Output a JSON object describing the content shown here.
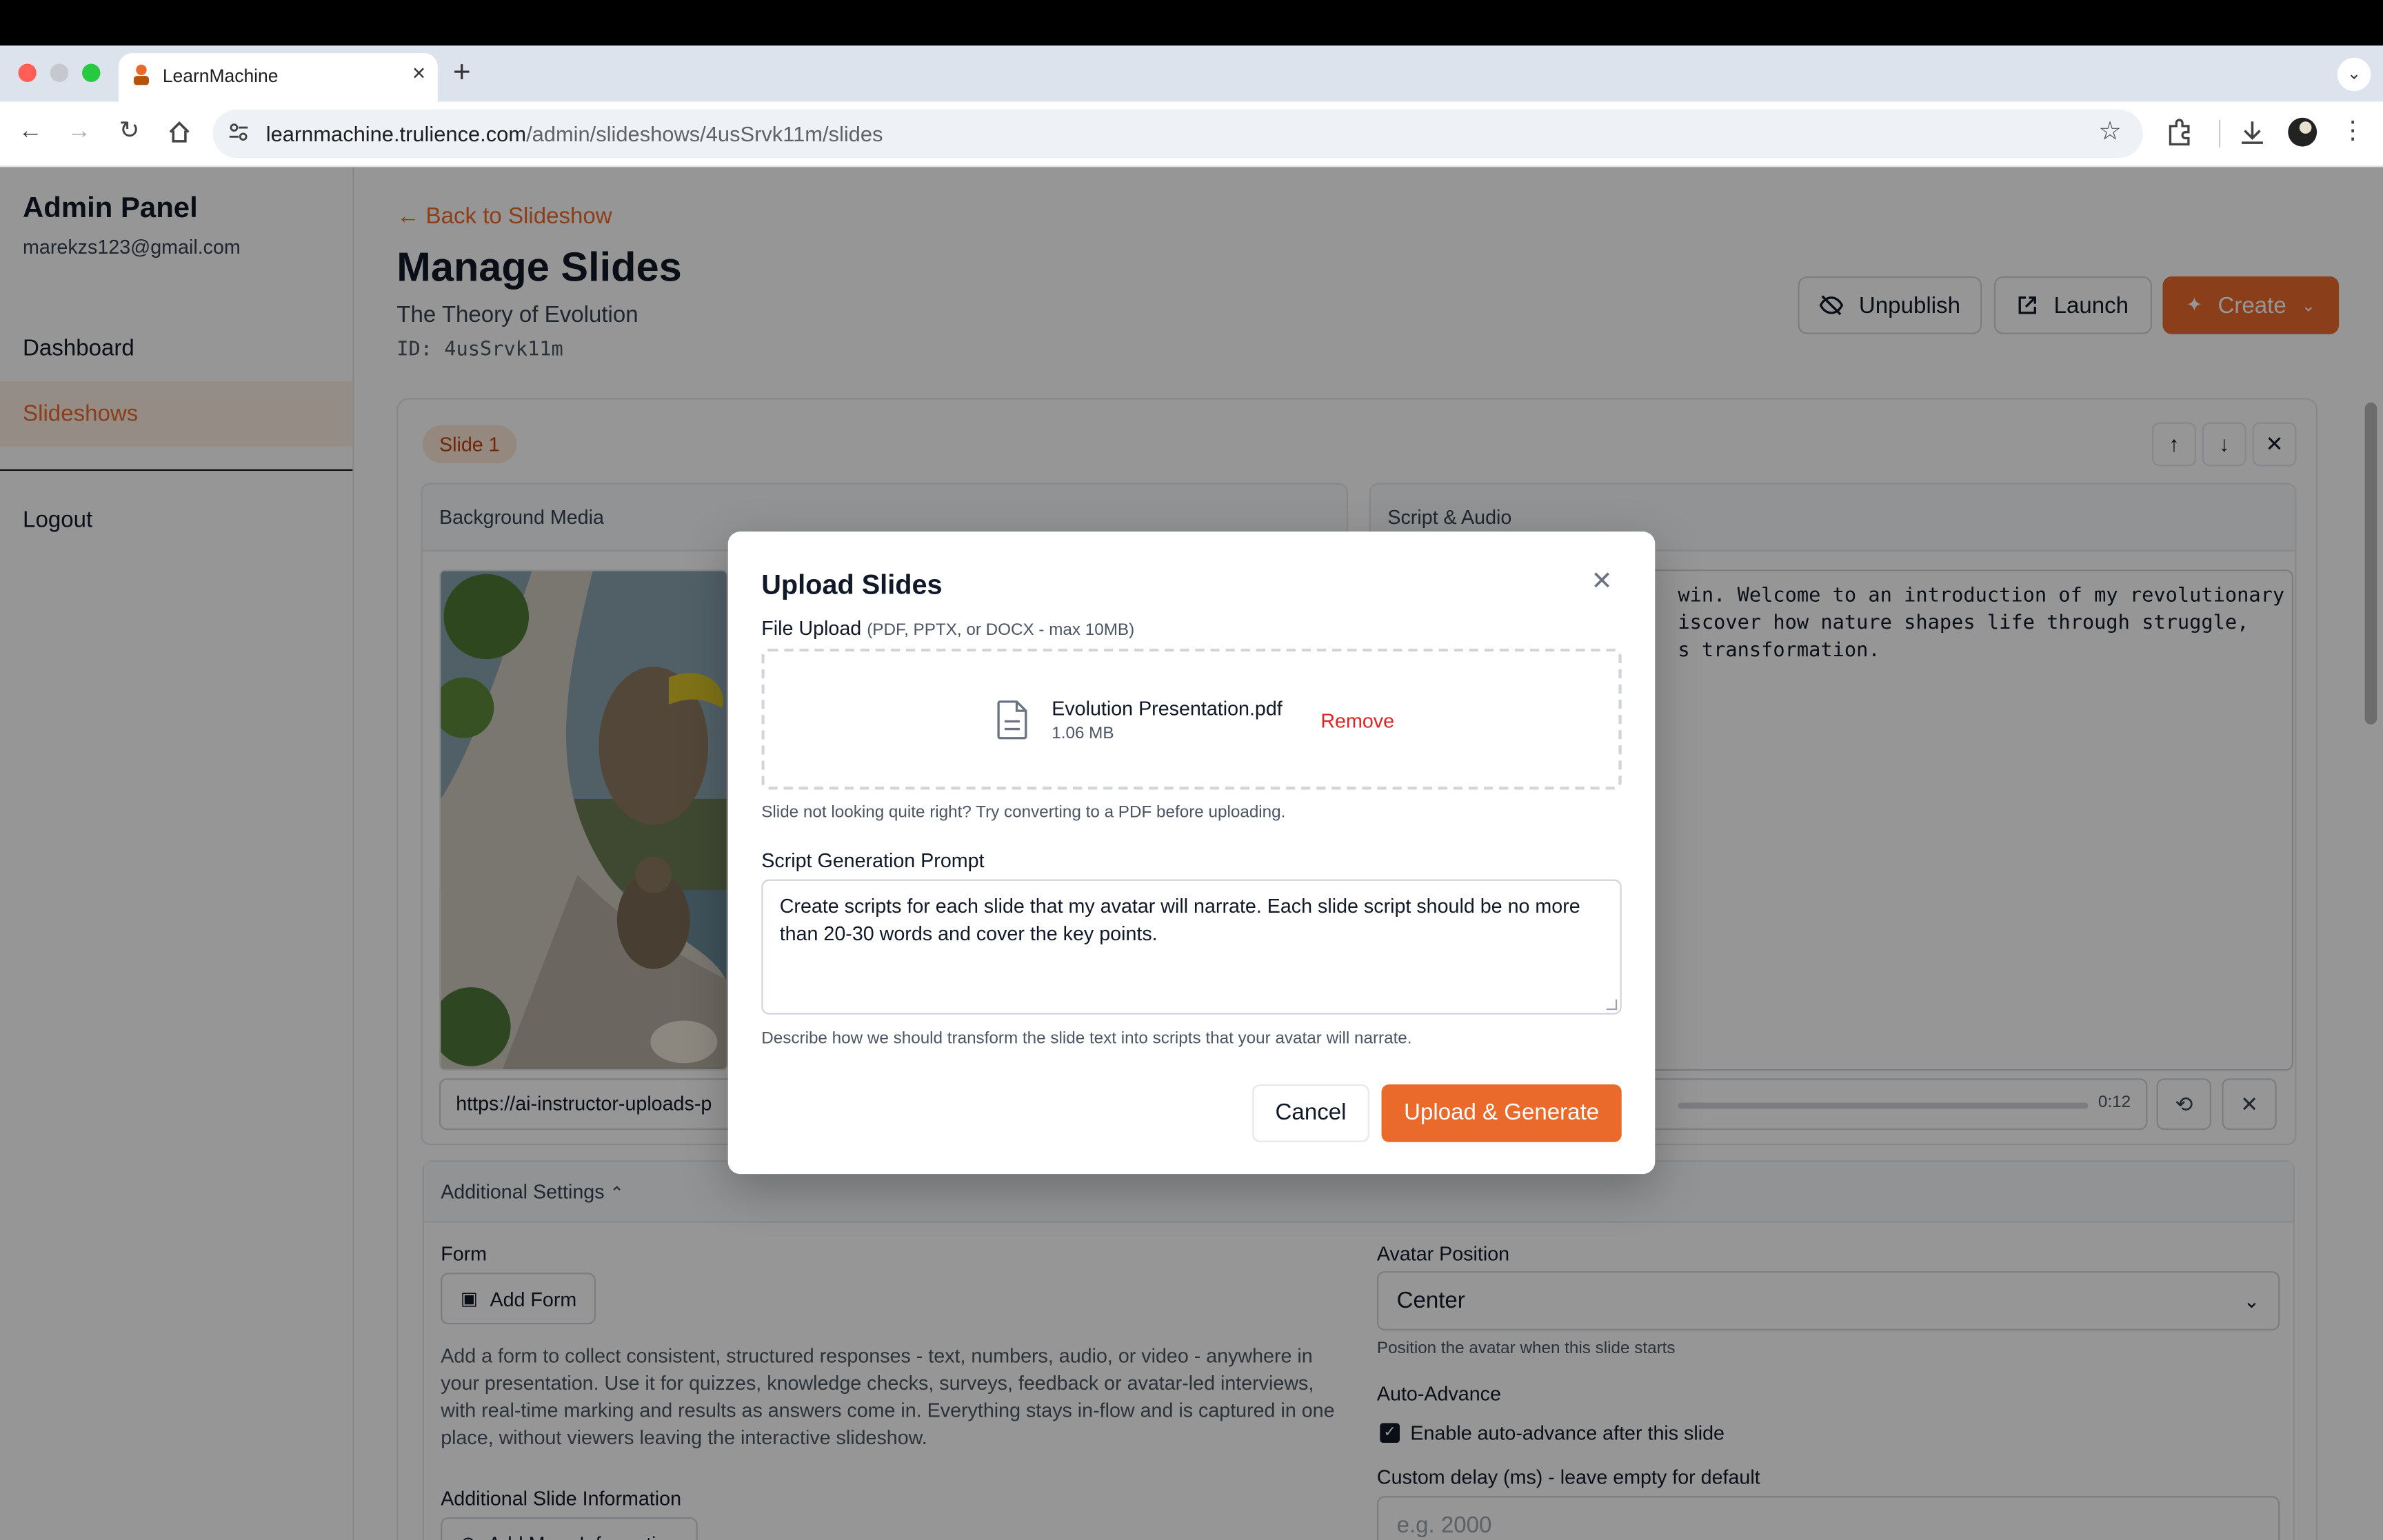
{
  "browser": {
    "tab_title": "LearnMachine",
    "url_host": "learnmachine.trulience.com",
    "url_path": "/admin/slideshows/4usSrvk11m/slides"
  },
  "sidebar": {
    "title": "Admin Panel",
    "email": "marekzs123@gmail.com",
    "items": [
      {
        "label": "Dashboard"
      },
      {
        "label": "Slideshows"
      }
    ],
    "logout_label": "Logout"
  },
  "page": {
    "back_label": "← Back to Slideshow",
    "title": "Manage Slides",
    "subtitle": "The Theory of Evolution",
    "id_text": "ID: 4usSrvk11m",
    "actions": {
      "unpublish": "Unpublish",
      "launch": "Launch",
      "create": "Create"
    }
  },
  "slide": {
    "badge": "Slide 1",
    "background_media_label": "Background Media",
    "media_url": "https://ai-instructor-uploads-p",
    "script_audio_label": "Script & Audio",
    "script_text": "win. Welcome to an introduction of my revolutionary\niscover how nature shapes life through struggle,\ns transformation.",
    "audio_time": "0:12"
  },
  "settings": {
    "header": "Additional Settings",
    "form_label": "Form",
    "add_form_label": "Add Form",
    "form_help": "Add a form to collect consistent, structured responses - text, numbers, audio, or video - anywhere in your presentation. Use it for quizzes, knowledge checks, surveys, feedback or avatar-led interviews, with real-time marking and results as answers come in. Everything stays in-flow and is captured in one place, without viewers leaving the interactive slideshow.",
    "additional_info_label": "Additional Slide Information",
    "add_more_info_label": "Add More Information",
    "avatar_position_label": "Avatar Position",
    "avatar_position_value": "Center",
    "avatar_position_help": "Position the avatar when this slide starts",
    "auto_advance_label": "Auto-Advance",
    "auto_advance_checkbox": "Enable auto-advance after this slide",
    "auto_advance_checked": true,
    "custom_delay_label": "Custom delay (ms) - leave empty for default",
    "custom_delay_placeholder": "e.g. 2000"
  },
  "modal": {
    "title": "Upload Slides",
    "file_upload_label": "File Upload",
    "file_upload_hint": "(PDF, PPTX, or DOCX - max 10MB)",
    "file_name": "Evolution Presentation.pdf",
    "file_size": "1.06 MB",
    "remove_label": "Remove",
    "convert_hint": "Slide not looking quite right? Try converting to a PDF before uploading.",
    "prompt_label": "Script Generation Prompt",
    "prompt_value": "Create scripts for each slide that my avatar will narrate. Each slide script should be no more than 20-30 words and cover the key points.",
    "prompt_help": "Describe how we should transform the slide text into scripts that your avatar will narrate.",
    "cancel_label": "Cancel",
    "submit_label": "Upload & Generate"
  },
  "colors": {
    "accent": "#ea6a2c",
    "danger": "#dc2626"
  }
}
